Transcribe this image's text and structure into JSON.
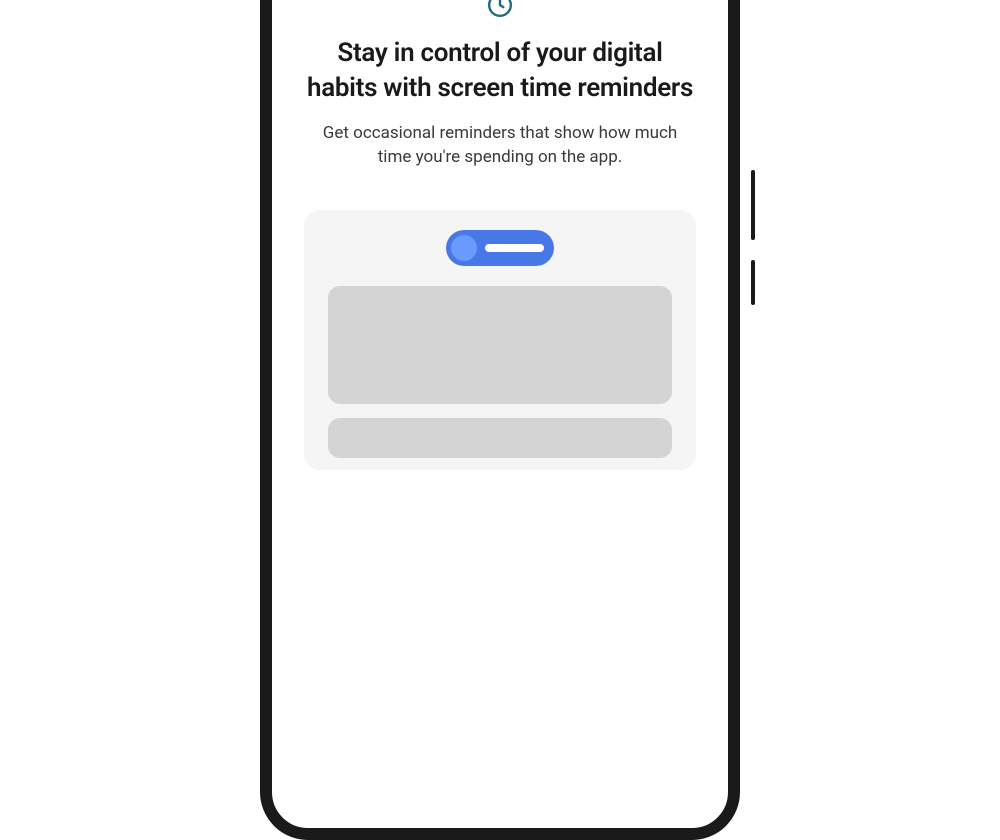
{
  "screen": {
    "title": "Stay in control of your digital habits with screen time reminders",
    "description": "Get occasional reminders that show how much time you're spending on the app."
  },
  "icons": {
    "clock_color": "#1e6b7a"
  },
  "illustration": {
    "toggle_bg": "#4878e8",
    "toggle_knob": "#6b9aff"
  }
}
